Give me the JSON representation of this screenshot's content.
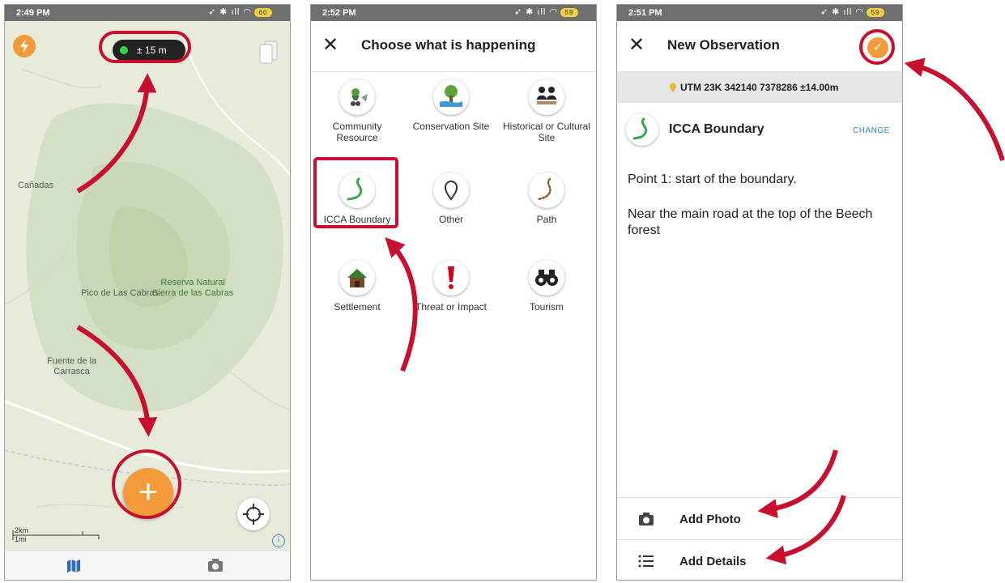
{
  "colors": {
    "accent_orange": "#f39b3a",
    "annotation_red": "#c8102e",
    "map_green": "#cfdcc0",
    "link_blue": "#3b82c4"
  },
  "phone1": {
    "status": {
      "time": "2:49 PM",
      "battery": "60"
    },
    "gps_accuracy": "± 15 m",
    "map_labels": {
      "canadas": "Cañadas",
      "reserva": "Reserva Natural\nSierra de las Cabras",
      "pico": "Pico de Las Cabras",
      "fuente": "Fuente de la\nCarrasca"
    },
    "scale": {
      "km": "2km",
      "mi": "1mi"
    },
    "icons": {
      "flash": "flash-icon",
      "layers": "layers-icon",
      "add": "plus-icon",
      "locate": "crosshair-icon",
      "info": "info-icon",
      "map_tab": "map-icon",
      "camera_tab": "camera-icon"
    },
    "info_glyph": "i",
    "add_glyph": "+"
  },
  "phone2": {
    "status": {
      "time": "2:52 PM",
      "battery": "59"
    },
    "close_glyph": "✕",
    "title": "Choose what is happening",
    "categories": [
      {
        "label": "Community Resource",
        "icon": "community-resource-icon"
      },
      {
        "label": "Conservation Site",
        "icon": "conservation-site-icon"
      },
      {
        "label": "Historical or Cultural Site",
        "icon": "historical-site-icon"
      },
      {
        "label": "ICCA Boundary",
        "icon": "icca-boundary-icon"
      },
      {
        "label": "Other",
        "icon": "map-pin-icon"
      },
      {
        "label": "Path",
        "icon": "path-icon"
      },
      {
        "label": "Settlement",
        "icon": "house-icon"
      },
      {
        "label": "Threat or Impact",
        "icon": "exclamation-icon"
      },
      {
        "label": "Tourism",
        "icon": "binoculars-icon"
      }
    ],
    "selected": "ICCA Boundary"
  },
  "phone3": {
    "status": {
      "time": "2:51 PM",
      "battery": "59"
    },
    "close_glyph": "✕",
    "title": "New Observation",
    "confirm_glyph": "✓",
    "coordinates": "UTM 23K 342140 7378286 ±14.00m",
    "category": "ICCA Boundary",
    "change_label": "CHANGE",
    "notes": [
      "Point 1: start of the boundary.",
      "Near the main road at the top of the Beech forest"
    ],
    "actions": {
      "photo": "Add Photo",
      "details": "Add Details"
    }
  }
}
